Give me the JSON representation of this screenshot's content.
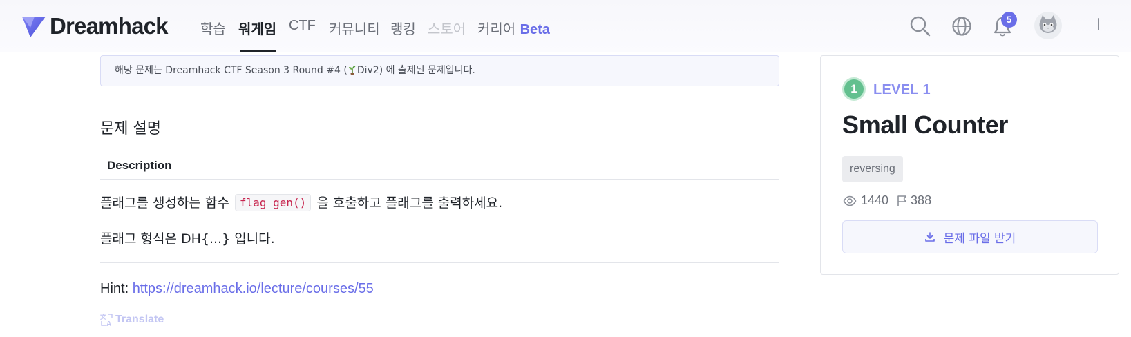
{
  "nav": {
    "brand": "Dreamhack",
    "items": [
      {
        "label": "학습",
        "state": "normal"
      },
      {
        "label": "워게임",
        "state": "active"
      },
      {
        "label": "CTF",
        "state": "normal"
      },
      {
        "label": "커뮤니티",
        "state": "normal"
      },
      {
        "label": "랭킹",
        "state": "normal"
      },
      {
        "label": "스토어",
        "state": "disabled"
      },
      {
        "label": "커리어",
        "state": "normal"
      }
    ],
    "career_badge": "Beta",
    "notification_count": "5",
    "icons": [
      "search-icon",
      "globe-icon",
      "bell-icon",
      "avatar",
      "more-icon"
    ],
    "accent_color": "#6a6ee8"
  },
  "notice": {
    "prefix": "해당 문제는 Dreamhack CTF Season 3 Round #4 (",
    "division": "Div2",
    "suffix": ") 에 출제된 문제입니다."
  },
  "description": {
    "section_title": "문제 설명",
    "heading": "Description",
    "line1_before": "플래그를 생성하는 함수 ",
    "line1_code": "flag_gen()",
    "line1_after": " 을 호출하고 플래그를 출력하세요.",
    "line2": "플래그 형식은 DH{...} 입니다.",
    "hint_label": "Hint: ",
    "hint_link": "https://dreamhack.io/lecture/courses/55",
    "translate_label": "Translate"
  },
  "challenge": {
    "level_number": "1",
    "level_label": "LEVEL 1",
    "title": "Small Counter",
    "tag": "reversing",
    "views": "1440",
    "solves": "388",
    "download_label": "문제 파일 받기",
    "level_color": "#63c08f"
  }
}
